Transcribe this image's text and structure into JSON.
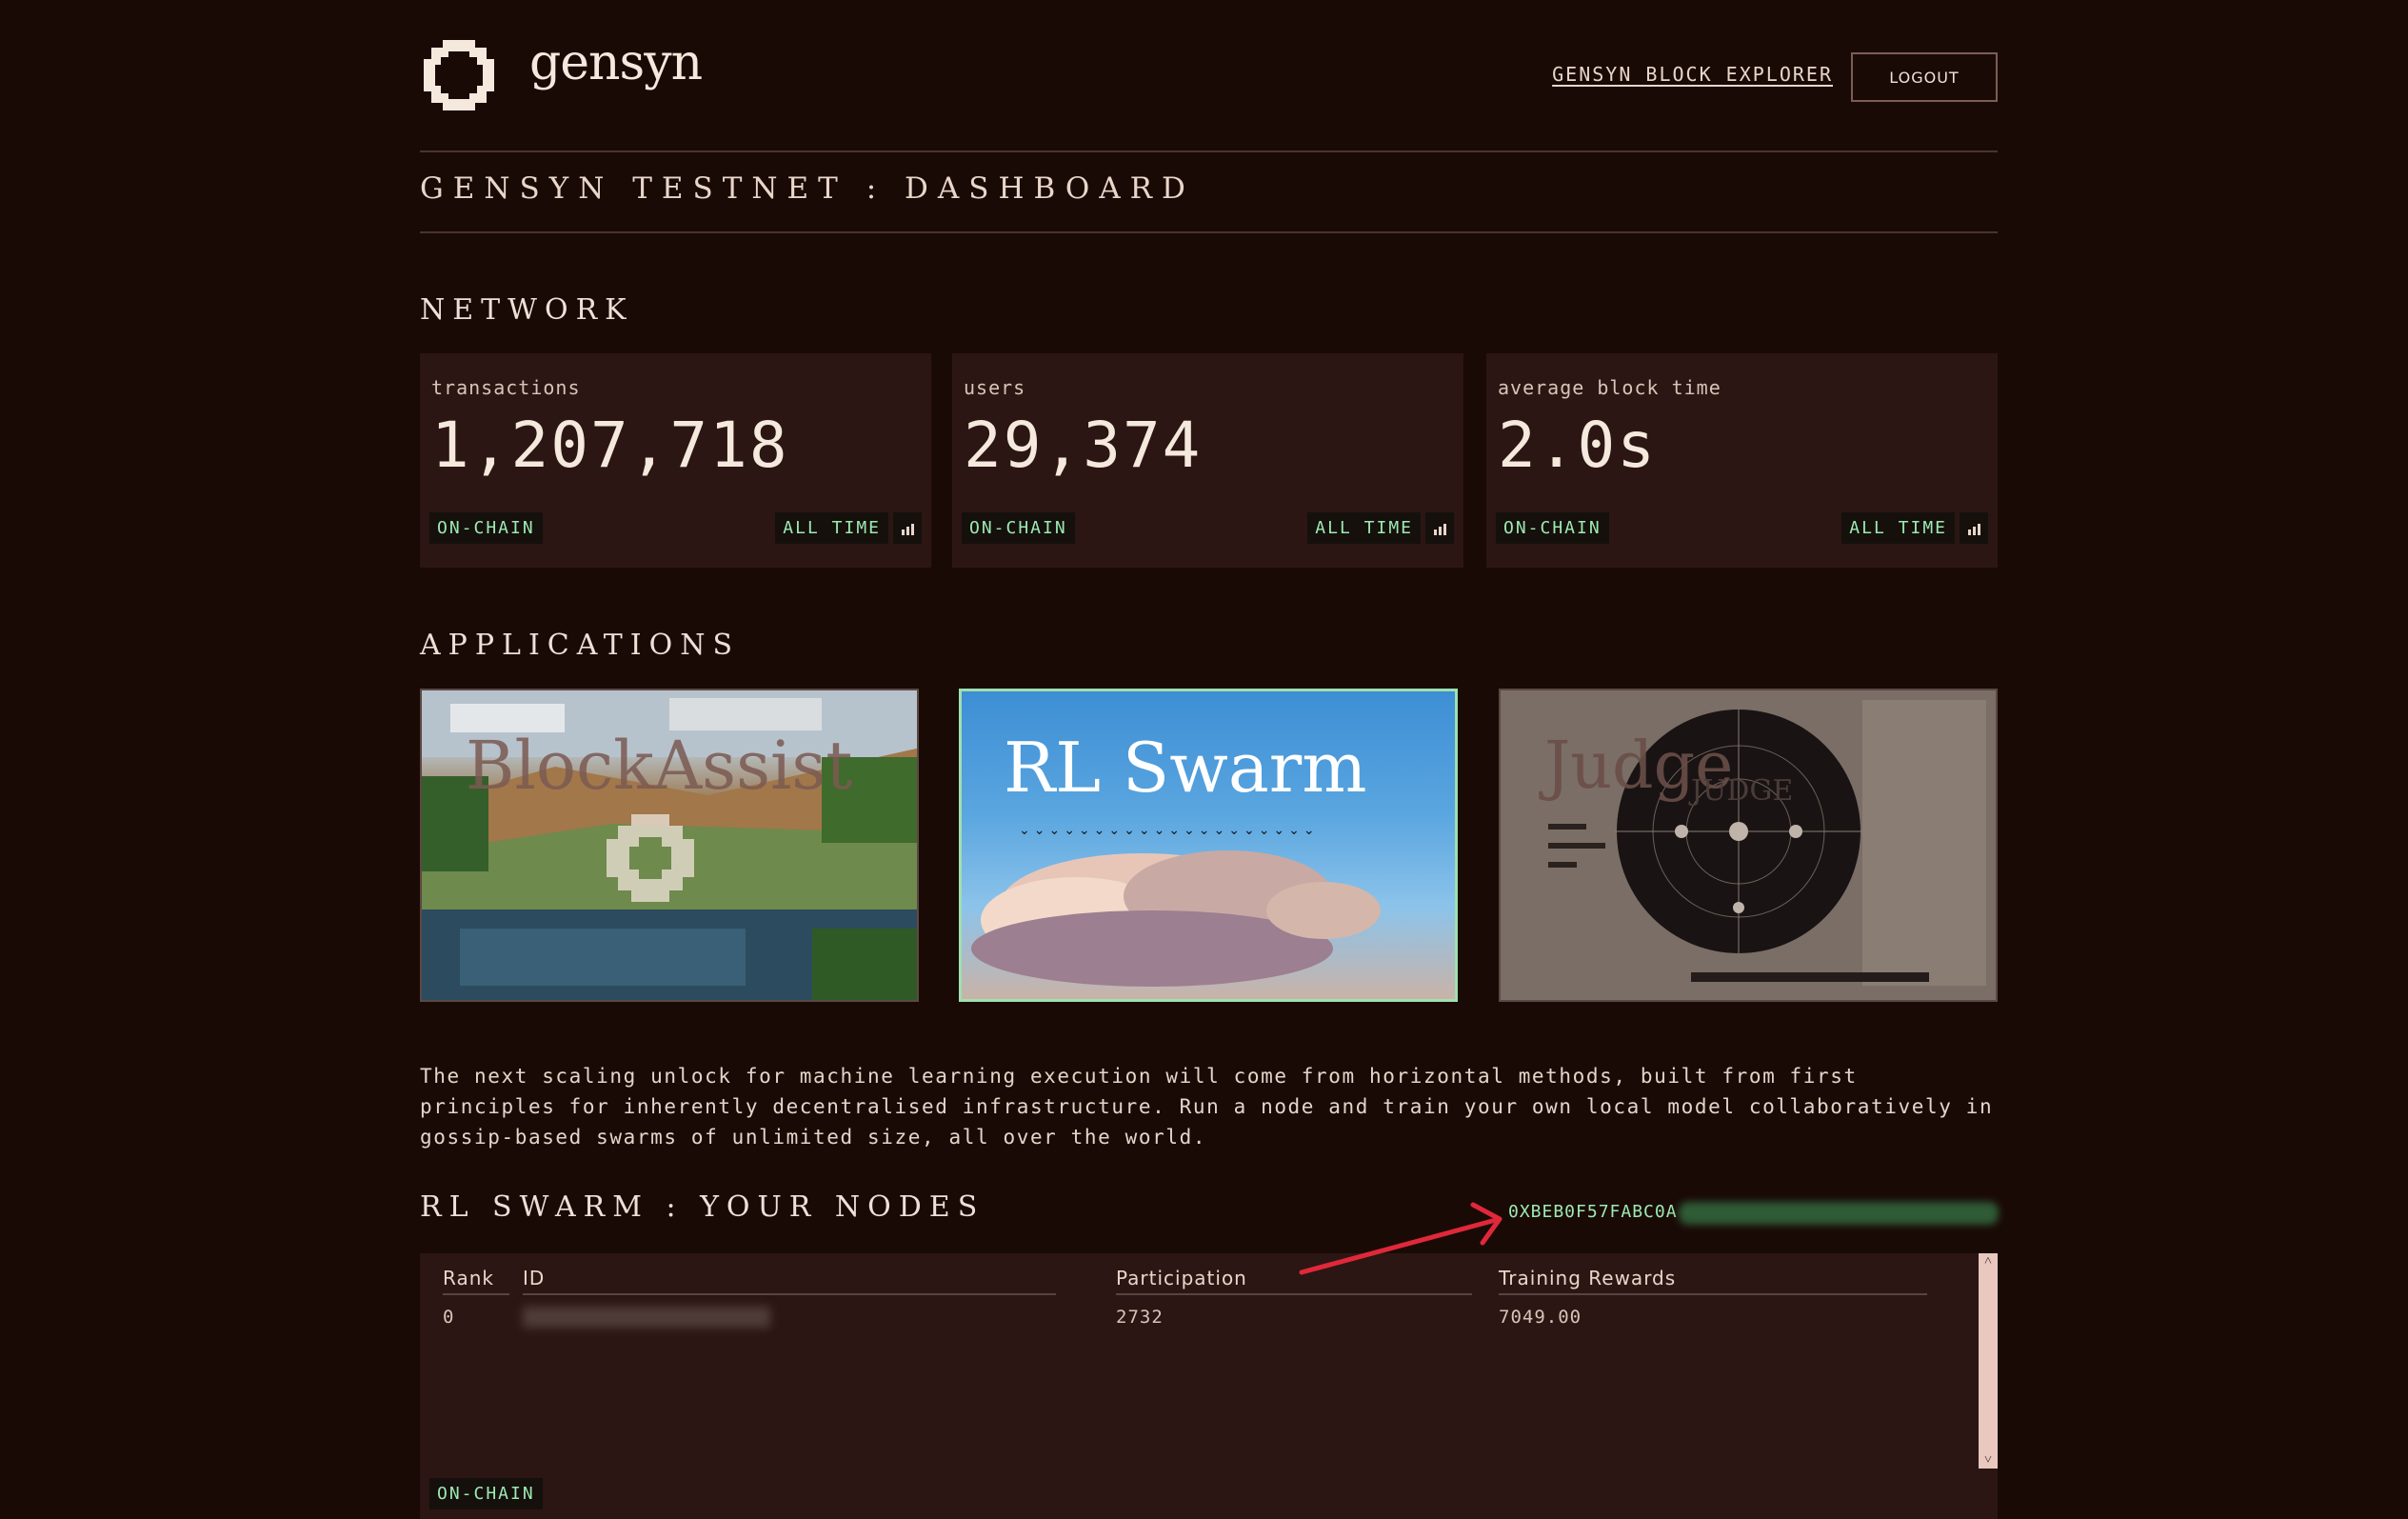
{
  "header": {
    "brand": "gensyn",
    "explorer_link": "GENSYN BLOCK EXPLORER",
    "logout": "LOGOUT"
  },
  "page_title": "GENSYN TESTNET : DASHBOARD",
  "network": {
    "title": "NETWORK",
    "cards": [
      {
        "label": "transactions",
        "value": "1,207,718",
        "badge": "ON-CHAIN",
        "period": "ALL TIME"
      },
      {
        "label": "users",
        "value": "29,374",
        "badge": "ON-CHAIN",
        "period": "ALL TIME"
      },
      {
        "label": "average block time",
        "value": "2.0s",
        "badge": "ON-CHAIN",
        "period": "ALL TIME"
      }
    ]
  },
  "applications": {
    "title": "APPLICATIONS",
    "tiles": [
      {
        "title": "BlockAssist"
      },
      {
        "title": "RL Swarm"
      },
      {
        "title": "Judge",
        "subtitle": "JUDGE"
      }
    ]
  },
  "description": "The next scaling unlock for machine learning execution will come from horizontal methods, built from first principles for inherently decentralised infrastructure. Run a node and train your own local model collaboratively in gossip-based swarms of unlimited size, all over the world.",
  "nodes": {
    "title": "RL SWARM : YOUR NODES",
    "wallet": "0XBEB0F57FABC0A",
    "columns": [
      "Rank",
      "ID",
      "Participation",
      "Training Rewards"
    ],
    "rows": [
      {
        "rank": "0",
        "participation": "2732",
        "rewards": "7049.00"
      }
    ],
    "badge": "ON-CHAIN"
  },
  "colors": {
    "background": "#1a0a06",
    "card": "#2b1613",
    "accent_green": "#9de9b2",
    "annotation_arrow": "#e0283a"
  }
}
